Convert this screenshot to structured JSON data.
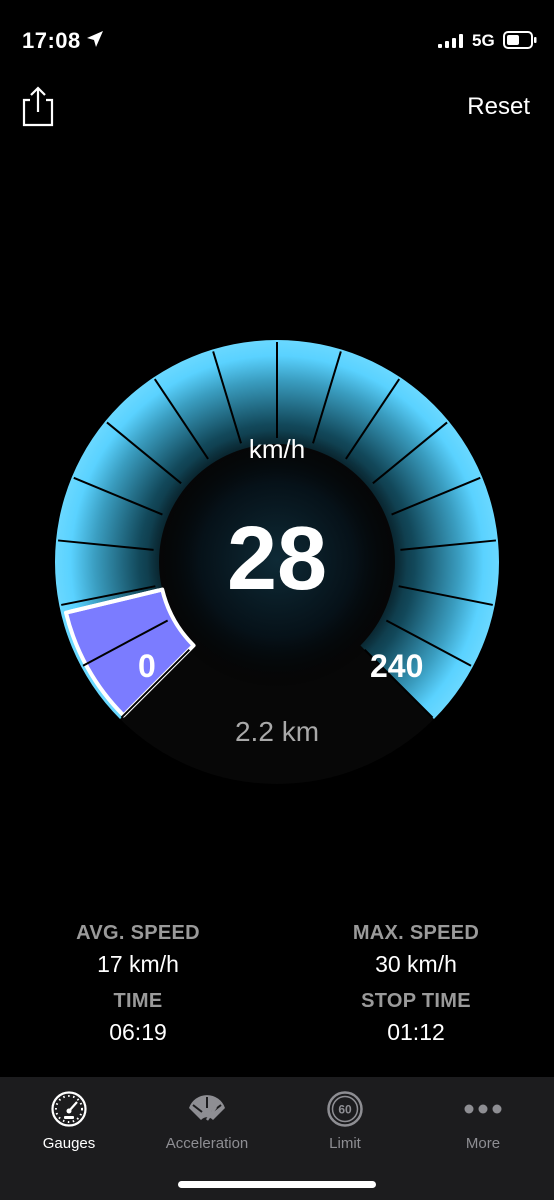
{
  "status_bar": {
    "time": "17:08",
    "network": "5G"
  },
  "header": {
    "reset_label": "Reset"
  },
  "gauge": {
    "unit": "km/h",
    "speed": "28",
    "min": "0",
    "max": "240",
    "distance": "2.2 km",
    "speed_value": 28,
    "scale_min": 0,
    "scale_max": 240
  },
  "stats": {
    "avg_speed": {
      "label": "AVG. SPEED",
      "value": "17 km/h"
    },
    "max_speed": {
      "label": "MAX. SPEED",
      "value": "30 km/h"
    },
    "time": {
      "label": "TIME",
      "value": "06:19"
    },
    "stop_time": {
      "label": "STOP TIME",
      "value": "01:12"
    }
  },
  "tabs": [
    {
      "label": "Gauges",
      "icon": "gauge-icon",
      "active": true
    },
    {
      "label": "Acceleration",
      "icon": "acceleration-icon",
      "active": false
    },
    {
      "label": "Limit",
      "icon": "speed-limit-icon",
      "active": false,
      "icon_text": "60"
    },
    {
      "label": "More",
      "icon": "more-dots-icon",
      "active": false
    }
  ],
  "colors": {
    "gauge_accent": "#5ad2ff",
    "progress": "#7b7cff",
    "background": "#000000",
    "tab_bar": "#1c1c1e"
  }
}
